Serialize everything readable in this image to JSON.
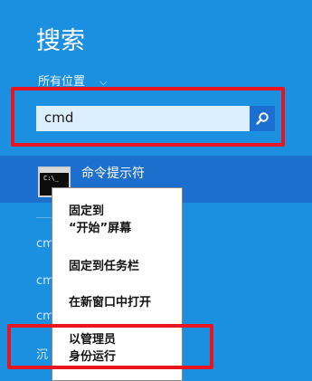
{
  "search_pane": {
    "title": "搜索",
    "scope_label": "所有位置",
    "scope_chevron": "⌵",
    "query_value": "cmd",
    "search_button_icon": "magnifier-icon"
  },
  "result": {
    "label": "命令提示符",
    "icon": "command-prompt-icon",
    "icon_text": "C:\\_"
  },
  "background_items": [
    "cm",
    "cm",
    "cm",
    "沉"
  ],
  "context_menu": {
    "items": [
      {
        "label": "固定到\n“开始”屏幕"
      },
      {
        "label": "固定到任务栏"
      },
      {
        "label": "在新窗口中打开"
      },
      {
        "label": "以管理员\n身份运行"
      }
    ]
  },
  "colors": {
    "background": "#1b8fe0",
    "selected_row": "#1c6fcd",
    "highlight": "#e8151f",
    "search_field": "#dcefff"
  }
}
